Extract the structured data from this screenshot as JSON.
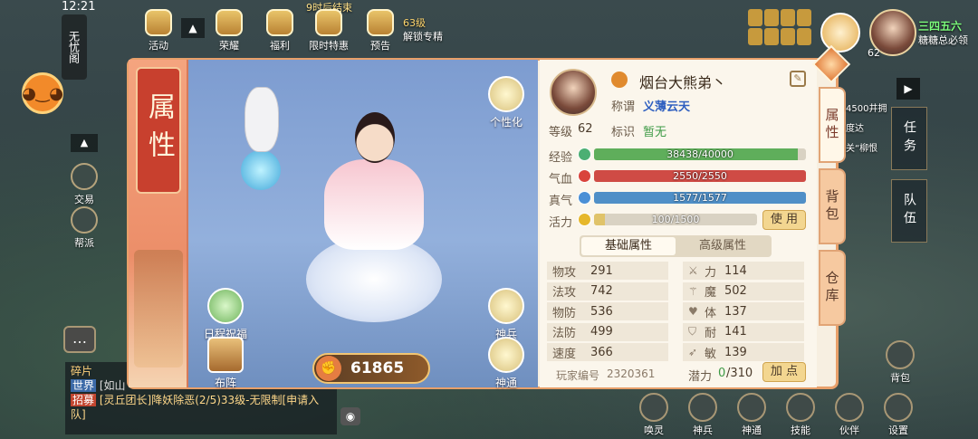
{
  "hud": {
    "time": "12:21",
    "event_timer": "9时后结束",
    "left_banner": "无忧阁",
    "top_icons": [
      "活动",
      "荣耀",
      "福利",
      "限时特惠",
      "预告"
    ],
    "unlock_level": "63级",
    "unlock_text": "解锁专精",
    "left_buttons": [
      "交易",
      "帮派"
    ],
    "player_level_badge": "62",
    "right_top_text": "三四五六",
    "right_top_sub": "糖糖总必领",
    "quest_snippet_1": "4500井拥",
    "quest_snippet_2": "度达",
    "quest_snippet_3": "关“柳恨"
  },
  "panel": {
    "title": "属性",
    "stage": {
      "personalize": "个性化",
      "daily_blessing": "日程祝福",
      "formation": "布阵",
      "divine_weapon": "神兵",
      "divine_power": "神通",
      "combat_power": "61865"
    },
    "info": {
      "name": "烟台大熊弟丶",
      "title_label": "称谓",
      "title_value": "义薄云天",
      "level_label": "等级",
      "level_value": "62",
      "mark_label": "标识",
      "mark_value": "暂无",
      "bars": [
        {
          "label": "经验",
          "text": "38438/40000",
          "ratio": 0.961,
          "color": "#5fae5b",
          "icon": "#4caf73"
        },
        {
          "label": "气血",
          "text": "2550/2550",
          "ratio": 1.0,
          "color": "#cf4b45",
          "icon": "#d9443c"
        },
        {
          "label": "真气",
          "text": "1577/1577",
          "ratio": 1.0,
          "color": "#4f8fc7",
          "icon": "#4a8fd6"
        },
        {
          "label": "活力",
          "text": "100/1500",
          "ratio": 0.067,
          "color": "#e0c36a",
          "icon": "#e6b72b"
        }
      ],
      "use_button": "使 用",
      "tabs": [
        "基础属性",
        "高级属性"
      ],
      "stats_left": [
        {
          "label": "物攻",
          "value": "291"
        },
        {
          "label": "法攻",
          "value": "742"
        },
        {
          "label": "物防",
          "value": "536"
        },
        {
          "label": "法防",
          "value": "499"
        },
        {
          "label": "速度",
          "value": "366"
        }
      ],
      "stats_right": [
        {
          "label": "力",
          "value": "114",
          "icon": "sword-icon"
        },
        {
          "label": "魔",
          "value": "502",
          "icon": "wand-icon"
        },
        {
          "label": "体",
          "value": "137",
          "icon": "heart-icon"
        },
        {
          "label": "耐",
          "value": "141",
          "icon": "shield-icon"
        },
        {
          "label": "敏",
          "value": "139",
          "icon": "boot-icon"
        }
      ],
      "player_id_label": "玩家编号",
      "player_id_value": "2320361",
      "potential_label": "潜力",
      "potential_value": "0",
      "potential_max": "/310",
      "add_button": "加 点"
    },
    "side_tabs": [
      "属性",
      "背包",
      "仓库"
    ]
  },
  "right_panel": [
    "任务",
    "队伍"
  ],
  "bottom_bar": [
    "唤灵",
    "神兵",
    "神通",
    "技能",
    "伙伴",
    "设置"
  ],
  "bag_label": "背包",
  "chat": {
    "header": "碎片",
    "line1_channel": "世界",
    "line1_text": "[如山",
    "line2_channel": "招募",
    "line2_text": "[灵丘团长]降妖除恶(2/5)33级-无限制[申请入队]"
  },
  "colors": {
    "panel_border": "#e8a06a",
    "accent_red": "#c8402e"
  }
}
